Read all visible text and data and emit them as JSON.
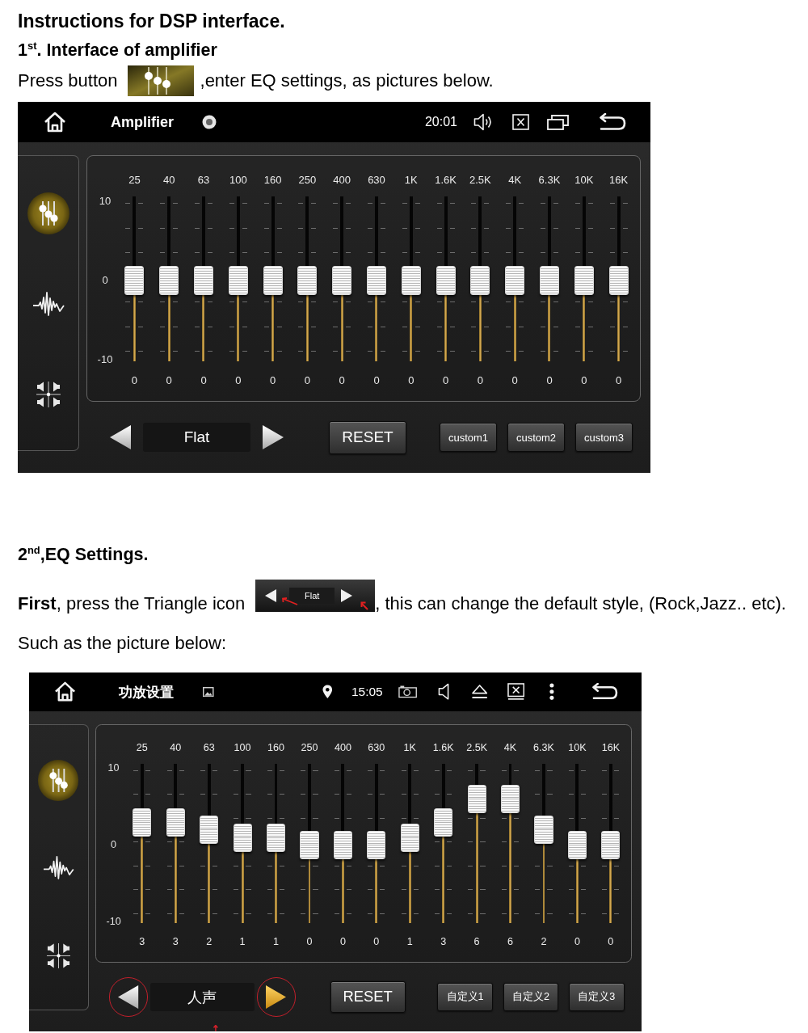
{
  "title": "Instructions for DSP interface.",
  "section_1": {
    "heading": "1$^{st}$. Interface of amplifier",
    "text_before": "Press button",
    "text_after": ",enter EQ settings, as pictures below."
  },
  "screen_1": {
    "status_bar": {
      "title": "Amplifier",
      "icons_after_title": [
        {
          "kind": "record"
        }
      ],
      "time": "20:01",
      "icons_after_time": [
        {
          "kind": "speaker-on"
        },
        {
          "kind": "close-box"
        },
        {
          "kind": "windows"
        }
      ]
    },
    "sidebar": [
      {
        "kind": "equalizer",
        "selected": true
      },
      {
        "kind": "waveform",
        "selected": false
      },
      {
        "kind": "balance",
        "selected": false
      }
    ],
    "scale": [
      "10",
      "0",
      "-10"
    ],
    "bands": [
      {
        "label": "25",
        "level": 0.5,
        "reading": "0"
      },
      {
        "label": "40",
        "level": 0.5,
        "reading": "0"
      },
      {
        "label": "63",
        "level": 0.5,
        "reading": "0"
      },
      {
        "label": "100",
        "level": 0.5,
        "reading": "0"
      },
      {
        "label": "160",
        "level": 0.5,
        "reading": "0"
      },
      {
        "label": "250",
        "level": 0.5,
        "reading": "0"
      },
      {
        "label": "400",
        "level": 0.5,
        "reading": "0"
      },
      {
        "label": "630",
        "level": 0.5,
        "reading": "0"
      },
      {
        "label": "1K",
        "level": 0.5,
        "reading": "0"
      },
      {
        "label": "1.6K",
        "level": 0.5,
        "reading": "0"
      },
      {
        "label": "2.5K",
        "level": 0.5,
        "reading": "0"
      },
      {
        "label": "4K",
        "level": 0.5,
        "reading": "0"
      },
      {
        "label": "6.3K",
        "level": 0.5,
        "reading": "0"
      },
      {
        "label": "10K",
        "level": 0.5,
        "reading": "0"
      },
      {
        "label": "16K",
        "level": 0.5,
        "reading": "0"
      }
    ],
    "preset": {
      "name": "Flat",
      "prev": {
        "circled": false,
        "pressed": false
      },
      "next": {
        "circled": false,
        "pressed": false
      }
    },
    "reset": "RESET",
    "custom_buttons": [
      "custom1",
      "custom2",
      "custom3"
    ]
  },
  "section_2": {
    "heading": "2$^{nd}$,EQ Settings.",
    "text_before": "**First**, press the Triangle icon",
    "inline_image": {
      "preset": "Flat"
    },
    "text_after": ", this can change the default style, (Rock,Jazz.. etc).",
    "note": "Such as the picture below:"
  },
  "screen_2": {
    "status_bar": {
      "title": "功放设置",
      "icons_after_title": [
        {
          "kind": "image"
        }
      ],
      "icons_before_time": [
        {
          "kind": "pin"
        }
      ],
      "time": "15:05",
      "icons_after_time": [
        {
          "kind": "camera"
        },
        {
          "kind": "speaker"
        },
        {
          "kind": "eject"
        },
        {
          "kind": "screen-close"
        },
        {
          "kind": "more"
        }
      ]
    },
    "sidebar": [
      {
        "kind": "equalizer",
        "selected": true
      },
      {
        "kind": "waveform",
        "selected": false
      },
      {
        "kind": "balance",
        "selected": false
      }
    ],
    "scale": [
      "10",
      "0",
      "-10"
    ],
    "bands": [
      {
        "label": "25",
        "level": 0.65,
        "reading": "3"
      },
      {
        "label": "40",
        "level": 0.65,
        "reading": "3"
      },
      {
        "label": "63",
        "level": 0.6,
        "reading": "2"
      },
      {
        "label": "100",
        "level": 0.55,
        "reading": "1"
      },
      {
        "label": "160",
        "level": 0.55,
        "reading": "1"
      },
      {
        "label": "250",
        "level": 0.5,
        "reading": "0"
      },
      {
        "label": "400",
        "level": 0.5,
        "reading": "0"
      },
      {
        "label": "630",
        "level": 0.5,
        "reading": "0"
      },
      {
        "label": "1K",
        "level": 0.55,
        "reading": "1"
      },
      {
        "label": "1.6K",
        "level": 0.65,
        "reading": "3"
      },
      {
        "label": "2.5K",
        "level": 0.8,
        "reading": "6"
      },
      {
        "label": "4K",
        "level": 0.8,
        "reading": "6"
      },
      {
        "label": "6.3K",
        "level": 0.6,
        "reading": "2"
      },
      {
        "label": "10K",
        "level": 0.5,
        "reading": "0"
      },
      {
        "label": "16K",
        "level": 0.5,
        "reading": "0"
      }
    ],
    "preset": {
      "name": "人声",
      "prev": {
        "circled": true,
        "pressed": false
      },
      "next": {
        "circled": true,
        "pressed": true
      }
    },
    "reset": "RESET",
    "custom_buttons": [
      "自定义1",
      "自定义2",
      "自定义3"
    ],
    "pointer_arrow": true
  }
}
